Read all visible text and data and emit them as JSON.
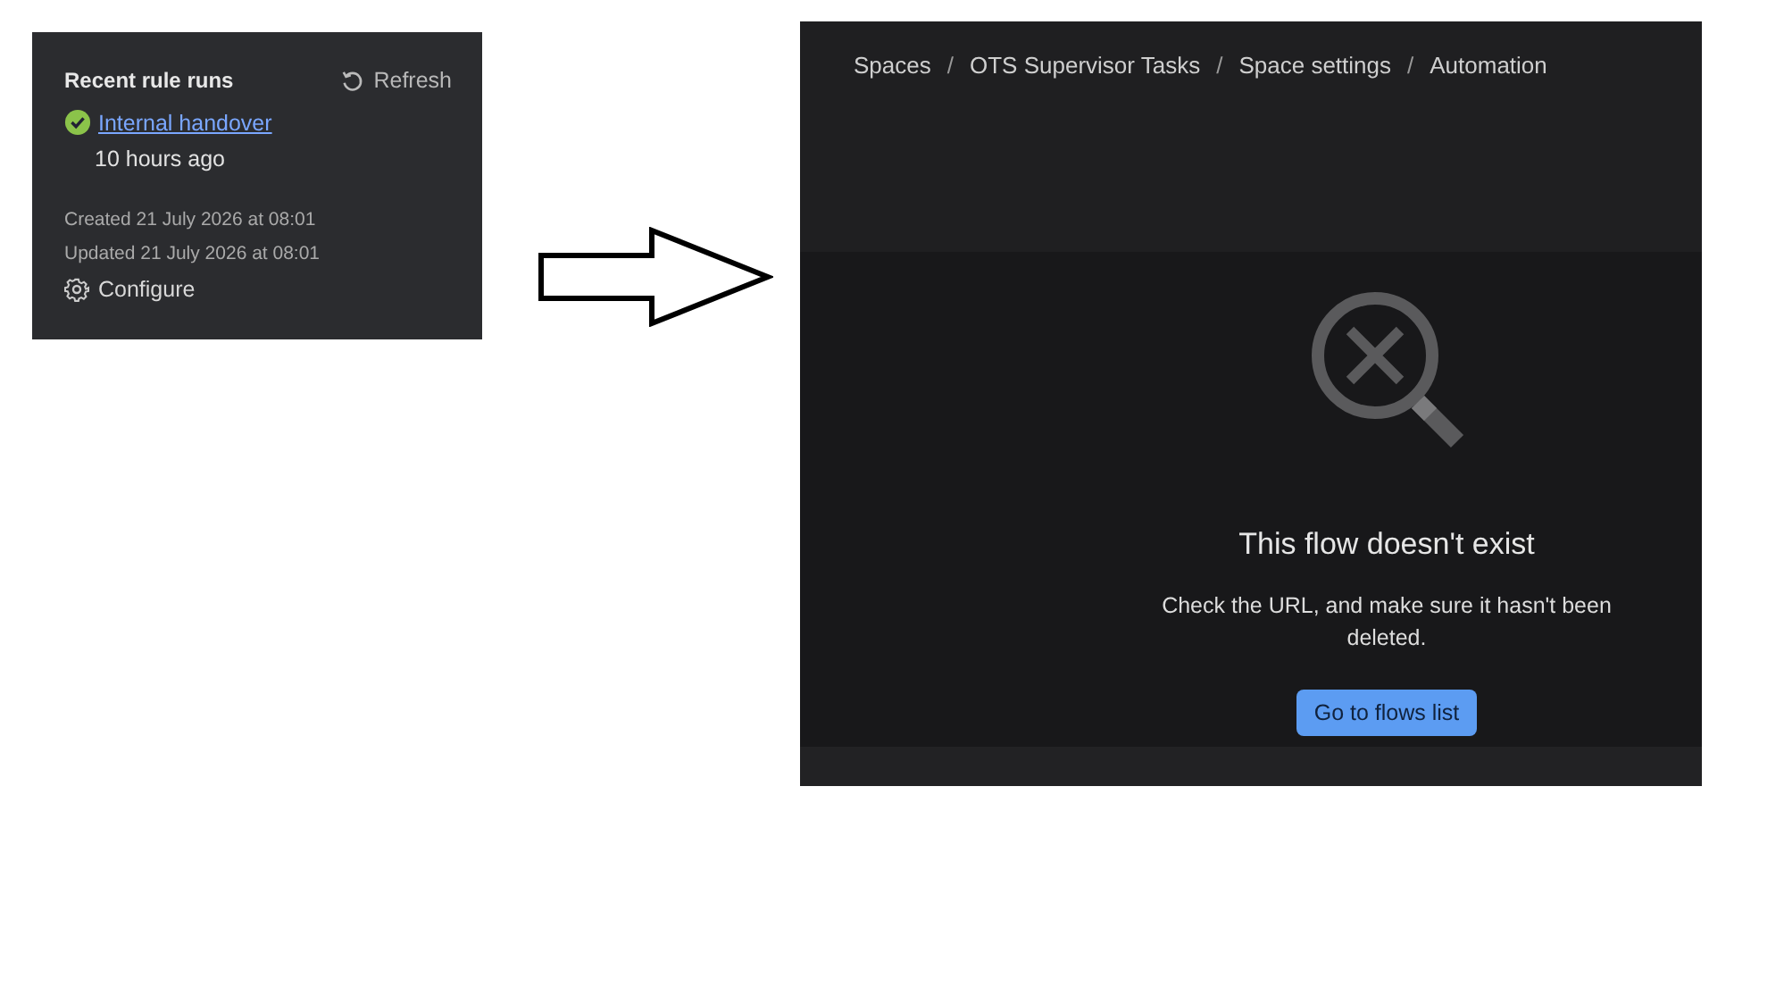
{
  "rule_panel": {
    "title": "Recent rule runs",
    "refresh": "Refresh",
    "runs": [
      {
        "name": "Internal handover",
        "succeeded": true,
        "time": "10 hours ago"
      }
    ],
    "created": "Created 21 July 2026 at 08:01",
    "updated": "Updated 21 July 2026 at 08:01",
    "configure": "Configure"
  },
  "flow_page": {
    "breadcrumbs": [
      "Spaces",
      "OTS Supervisor Tasks",
      "Space settings",
      "Automation"
    ],
    "breadcrumb_separators": [
      "/",
      "/",
      "/"
    ],
    "empty_state": {
      "title": "This flow doesn't exist",
      "message": "Check the URL, and make sure it hasn't been deleted.",
      "button": "Go to flows list"
    }
  }
}
